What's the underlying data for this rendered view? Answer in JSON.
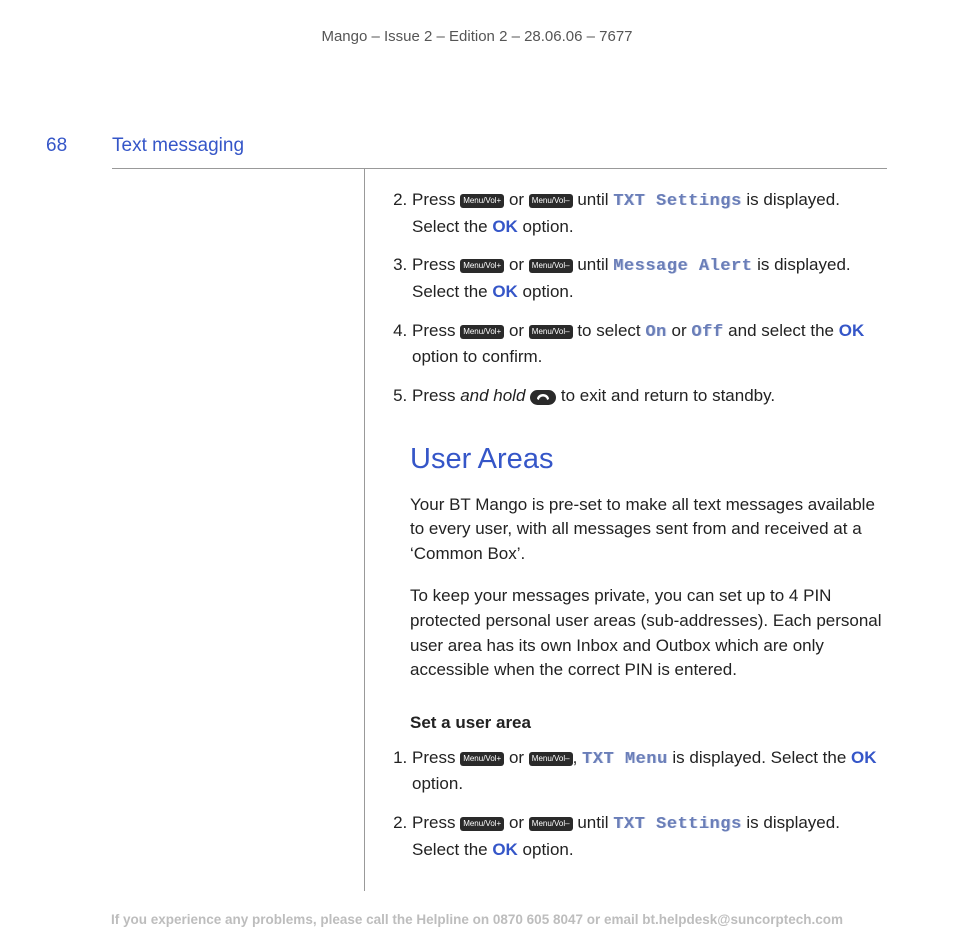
{
  "meta": {
    "header": "Mango – Issue 2 – Edition 2 – 28.06.06 – 7677"
  },
  "page": {
    "number": "68",
    "section": "Text messaging"
  },
  "keys": {
    "menuPlus": "Menu/Vol+",
    "menuMinus": "Menu/Vol–"
  },
  "steps1": {
    "s2_a": "Press ",
    "s2_or": " or ",
    "s2_b": " until ",
    "s2_lcd": "TXT Settings",
    "s2_c": " is displayed. Select the ",
    "s2_ok": "OK",
    "s2_d": " option.",
    "s3_a": "Press ",
    "s3_or": " or ",
    "s3_b": " until ",
    "s3_lcd": "Message Alert",
    "s3_c": " is displayed. Select the ",
    "s3_ok": "OK",
    "s3_d": " option.",
    "s4_a": "Press ",
    "s4_or": " or ",
    "s4_b": " to select ",
    "s4_lcd1": "On",
    "s4_mid": " or ",
    "s4_lcd2": "Off",
    "s4_c": " and select the ",
    "s4_ok": "OK",
    "s4_d": " option to confirm.",
    "s5_a": "Press ",
    "s5_hold": "and hold",
    "s5_b": " to exit and return to standby."
  },
  "userAreas": {
    "heading": "User Areas",
    "p1": "Your BT Mango is pre-set to make all text messages available to every user, with all messages sent from and received at a ‘Common Box’.",
    "p2": "To keep your messages private, you can set up to 4 PIN protected personal user areas (sub-addresses). Each personal user area has its own Inbox and Outbox which are only accessible when the correct PIN is entered.",
    "sub": "Set a user area"
  },
  "steps2": {
    "s1_a": "Press ",
    "s1_or": " or ",
    "s1_comma": ", ",
    "s1_lcd": "TXT Menu",
    "s1_b": " is displayed. Select the ",
    "s1_ok": "OK",
    "s1_c": " option.",
    "s2_a": "Press ",
    "s2_or": " or ",
    "s2_b": " until ",
    "s2_lcd": "TXT Settings",
    "s2_c": " is displayed. Select the ",
    "s2_ok": "OK",
    "s2_d": " option."
  },
  "footer": {
    "a": "If you experience any problems, please call the Helpline on ",
    "phone": "0870 605 8047",
    "b": " or ",
    "email_label": "email bt.helpdesk@suncorptech.com"
  }
}
